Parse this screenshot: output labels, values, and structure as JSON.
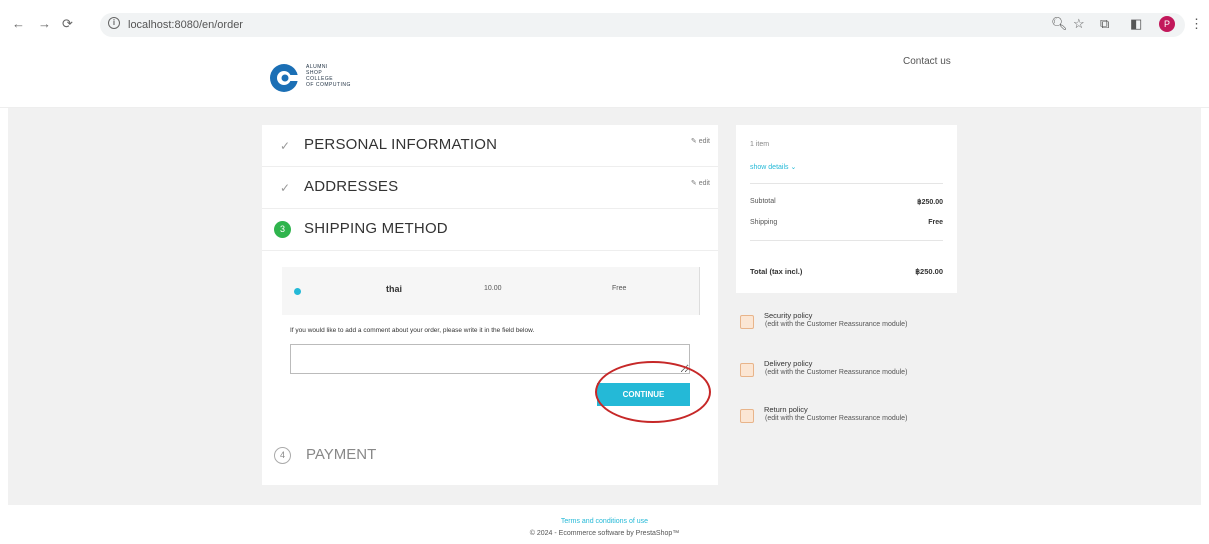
{
  "browser": {
    "back": "←",
    "forward": "→",
    "reload": "⟳",
    "url": "localhost:8080/en/order",
    "profile_initial": "P"
  },
  "header": {
    "logo_lines": [
      "ALUMNI",
      "SHOP",
      "COLLEGE",
      "OF COMPUTING"
    ],
    "contact": "Contact us"
  },
  "steps": {
    "personal": {
      "title": "PERSONAL INFORMATION",
      "edit": "edit"
    },
    "addresses": {
      "title": "ADDRESSES",
      "edit": "edit"
    },
    "shipping": {
      "number": "3",
      "title": "SHIPPING METHOD"
    },
    "payment": {
      "number": "4",
      "title": "PAYMENT"
    }
  },
  "shipping": {
    "carrier_name": "thai",
    "carrier_delay": "10.00",
    "carrier_price": "Free",
    "comment_label": "If you would like to add a comment about your order, please write it in the field below.",
    "comment_value": "",
    "continue_label": "CONTINUE"
  },
  "summary": {
    "items": "1 item",
    "show_details": "show details ⌄",
    "subtotal_label": "Subtotal",
    "subtotal_value": "฿250.00",
    "shipping_label": "Shipping",
    "shipping_value": "Free",
    "total_label": "Total (tax incl.)",
    "total_value": "฿250.00"
  },
  "reassurance": [
    {
      "title": "Security policy",
      "desc": "(edit with the Customer Reassurance module)"
    },
    {
      "title": "Delivery policy",
      "desc": "(edit with the Customer Reassurance module)"
    },
    {
      "title": "Return policy",
      "desc": "(edit with the Customer Reassurance module)"
    }
  ],
  "footer": {
    "terms": "Terms and conditions of use",
    "copyright": "© 2024 - Ecommerce software by PrestaShop™"
  },
  "colors": {
    "accent": "#24b9d7",
    "success": "#2fb44d",
    "annotation": "#c62828"
  }
}
